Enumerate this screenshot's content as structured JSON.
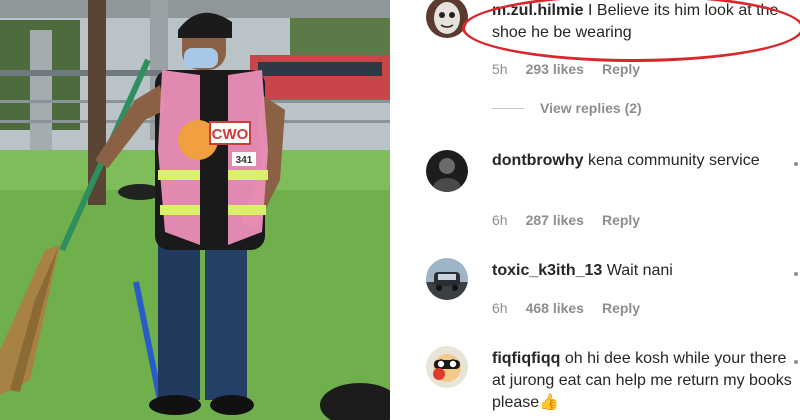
{
  "photo": {
    "vest_text": "CWO",
    "badge_number": "341"
  },
  "comments": [
    {
      "username": "m.zul.hilmie",
      "text": "I Believe its him look at the shoe he be wearing",
      "time": "5h",
      "likes": "293 likes",
      "reply_label": "Reply",
      "avatar_icon": "mask-avatar-icon"
    },
    {
      "username": "dontbrowhy",
      "text": "kena community service",
      "time": "6h",
      "likes": "287 likes",
      "reply_label": "Reply",
      "avatar_icon": "dark-avatar-icon"
    },
    {
      "username": "toxic_k3ith_13",
      "text": "Wait nani",
      "time": "6h",
      "likes": "468 likes",
      "reply_label": "Reply",
      "avatar_icon": "car-avatar-icon"
    },
    {
      "username": "fiqfiqfiqq",
      "text": "oh hi dee kosh while your there at jurong eat can help me return my books please👍",
      "time": "",
      "likes": "",
      "reply_label": "",
      "avatar_icon": "cartoon-avatar-icon"
    }
  ],
  "view_replies_label": "View replies (2)",
  "colors": {
    "highlight": "#d9272e",
    "username": "#262626",
    "meta": "#8e8e8e"
  }
}
